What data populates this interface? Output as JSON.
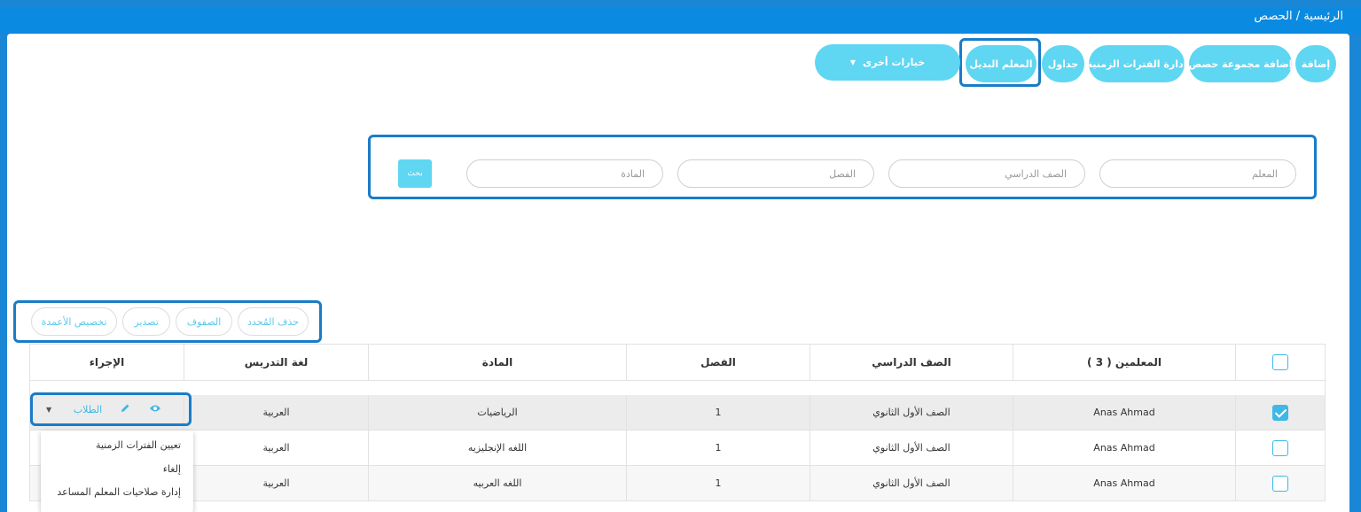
{
  "breadcrumb": "الرئيسية / الحصص",
  "toolbar": {
    "add": "إضافة",
    "add_group": "إضافة مجموعة حصص",
    "manage_periods": "إدارة الفترات الزمنية",
    "schedules": "جداول",
    "substitute": "المعلم البديل",
    "more_options": "خيارات أخرى"
  },
  "search": {
    "teacher_placeholder": "المعلم",
    "grade_placeholder": "الصف الدراسي",
    "class_placeholder": "الفصل",
    "subject_placeholder": "المادة",
    "button": "بحث"
  },
  "table_tools": {
    "delete_selected": "حذف المُحدد",
    "rows": "الصفوف",
    "export": "تصدير",
    "customize_columns": "تخصيص الأعمدة"
  },
  "table": {
    "headers": {
      "teachers": "المعلمين ( 3 )",
      "grade": "الصف الدراسي",
      "class": "الفصل",
      "subject": "المادة",
      "language": "لغة التدريس",
      "action": "الإجراء"
    },
    "rows": [
      {
        "teacher": "Anas Ahmad",
        "grade": "الصف الأول الثانوي",
        "class": "1",
        "subject": "الرياضيات",
        "language": "العربية",
        "checked": true
      },
      {
        "teacher": "Anas Ahmad",
        "grade": "الصف الأول الثانوي",
        "class": "1",
        "subject": "اللغه الإنجليزيه",
        "language": "العربية",
        "checked": false
      },
      {
        "teacher": "Anas Ahmad",
        "grade": "الصف الأول الثانوي",
        "class": "1",
        "subject": "اللغه العربيه",
        "language": "العربية",
        "checked": false
      }
    ],
    "row_actions": {
      "students": "الطلاب"
    }
  },
  "action_menu": {
    "items": [
      "تعيين الفترات الزمنية",
      "إلغاء",
      "إدارة صلاحيات المعلم المساعد"
    ]
  },
  "colors": {
    "primary": "#0a8ae0",
    "accent": "#5fd6f2",
    "highlight": "#1a7cc7"
  },
  "icons": [
    "eye-icon",
    "pencil-icon",
    "caret-down-icon"
  ]
}
